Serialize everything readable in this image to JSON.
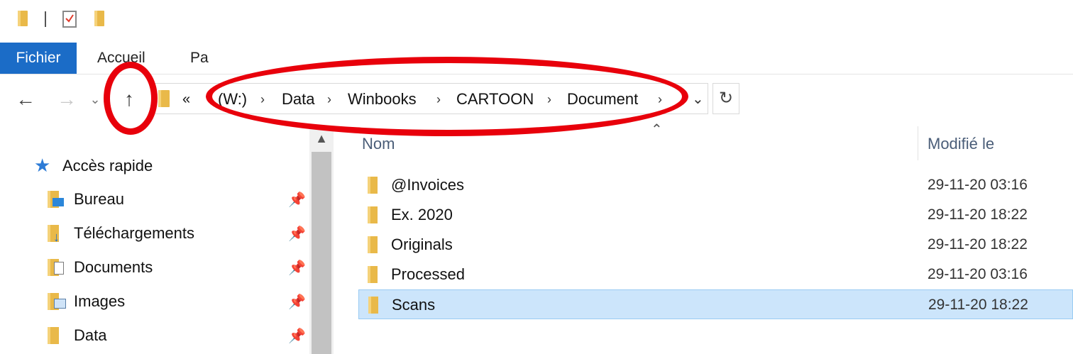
{
  "ribbon": {
    "tabs": [
      "Fichier",
      "Accueil",
      "Pa"
    ]
  },
  "address_bar": {
    "collapsed_marker": "«",
    "crumbs": [
      "(W:)",
      "Data",
      "Winbooks",
      "CARTOON",
      "Document"
    ]
  },
  "nav_pane": {
    "quick_access": "Accès rapide",
    "items": [
      {
        "label": "Bureau",
        "icon": "desktop-folder-icon"
      },
      {
        "label": "Téléchargements",
        "icon": "downloads-folder-icon"
      },
      {
        "label": "Documents",
        "icon": "documents-folder-icon"
      },
      {
        "label": "Images",
        "icon": "pictures-folder-icon"
      },
      {
        "label": "Data",
        "icon": "folder-icon"
      }
    ]
  },
  "file_list": {
    "columns": {
      "name": "Nom",
      "modified": "Modifié le"
    },
    "rows": [
      {
        "name": "@Invoices",
        "modified": "29-11-20 03:16",
        "selected": false
      },
      {
        "name": "Ex. 2020",
        "modified": "29-11-20 18:22",
        "selected": false
      },
      {
        "name": "Originals",
        "modified": "29-11-20 18:22",
        "selected": false
      },
      {
        "name": "Processed",
        "modified": "29-11-20 03:16",
        "selected": false
      },
      {
        "name": "Scans",
        "modified": "29-11-20 18:22",
        "selected": true
      }
    ]
  },
  "colors": {
    "file_tab": "#1b6cc7",
    "selection": "#cce5fb",
    "annotation": "#e8000b",
    "folder": "#e9b949"
  }
}
